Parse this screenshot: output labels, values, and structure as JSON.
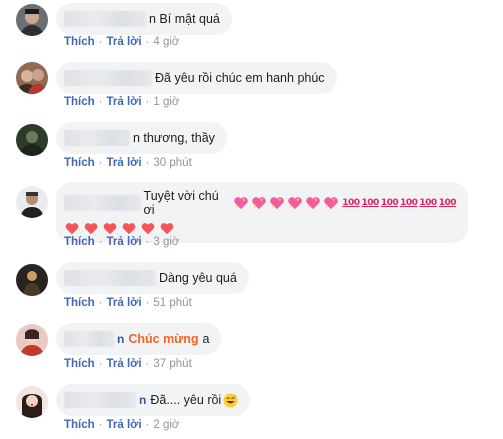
{
  "actions": {
    "like": "Thích",
    "reply": "Trả lời",
    "sep": "·"
  },
  "comments": [
    {
      "name_end": "",
      "text": "n Bí mật quá",
      "time": "4 giờ"
    },
    {
      "name_end": "",
      "text": "Đã yêu rồi chúc em hanh phúc",
      "time": "1 giờ"
    },
    {
      "name_end": "",
      "text": "n thương, thầy",
      "time": "30 phút"
    },
    {
      "name_end": "",
      "text": "Tuyệt vời chú ơi",
      "time": "3 giờ",
      "hundred": "100"
    },
    {
      "name_end": "",
      "text": "Dàng yêu quá",
      "time": "51 phút"
    },
    {
      "name_end": "n",
      "text": "Chúc mừng",
      "text2": "a",
      "time": "37 phút"
    },
    {
      "name_end": "n",
      "text": "Đã.... yêu rồi",
      "time": "2 giờ"
    }
  ],
  "colors": {
    "link": "#4267b2",
    "bubble": "#f2f3f5",
    "meta": "#90949c",
    "highlight": "#f26522"
  },
  "icons": [
    "avatar",
    "sparkling-heart-icon",
    "hundred-points-icon",
    "red-heart-icon",
    "grinning-sweat-icon"
  ]
}
